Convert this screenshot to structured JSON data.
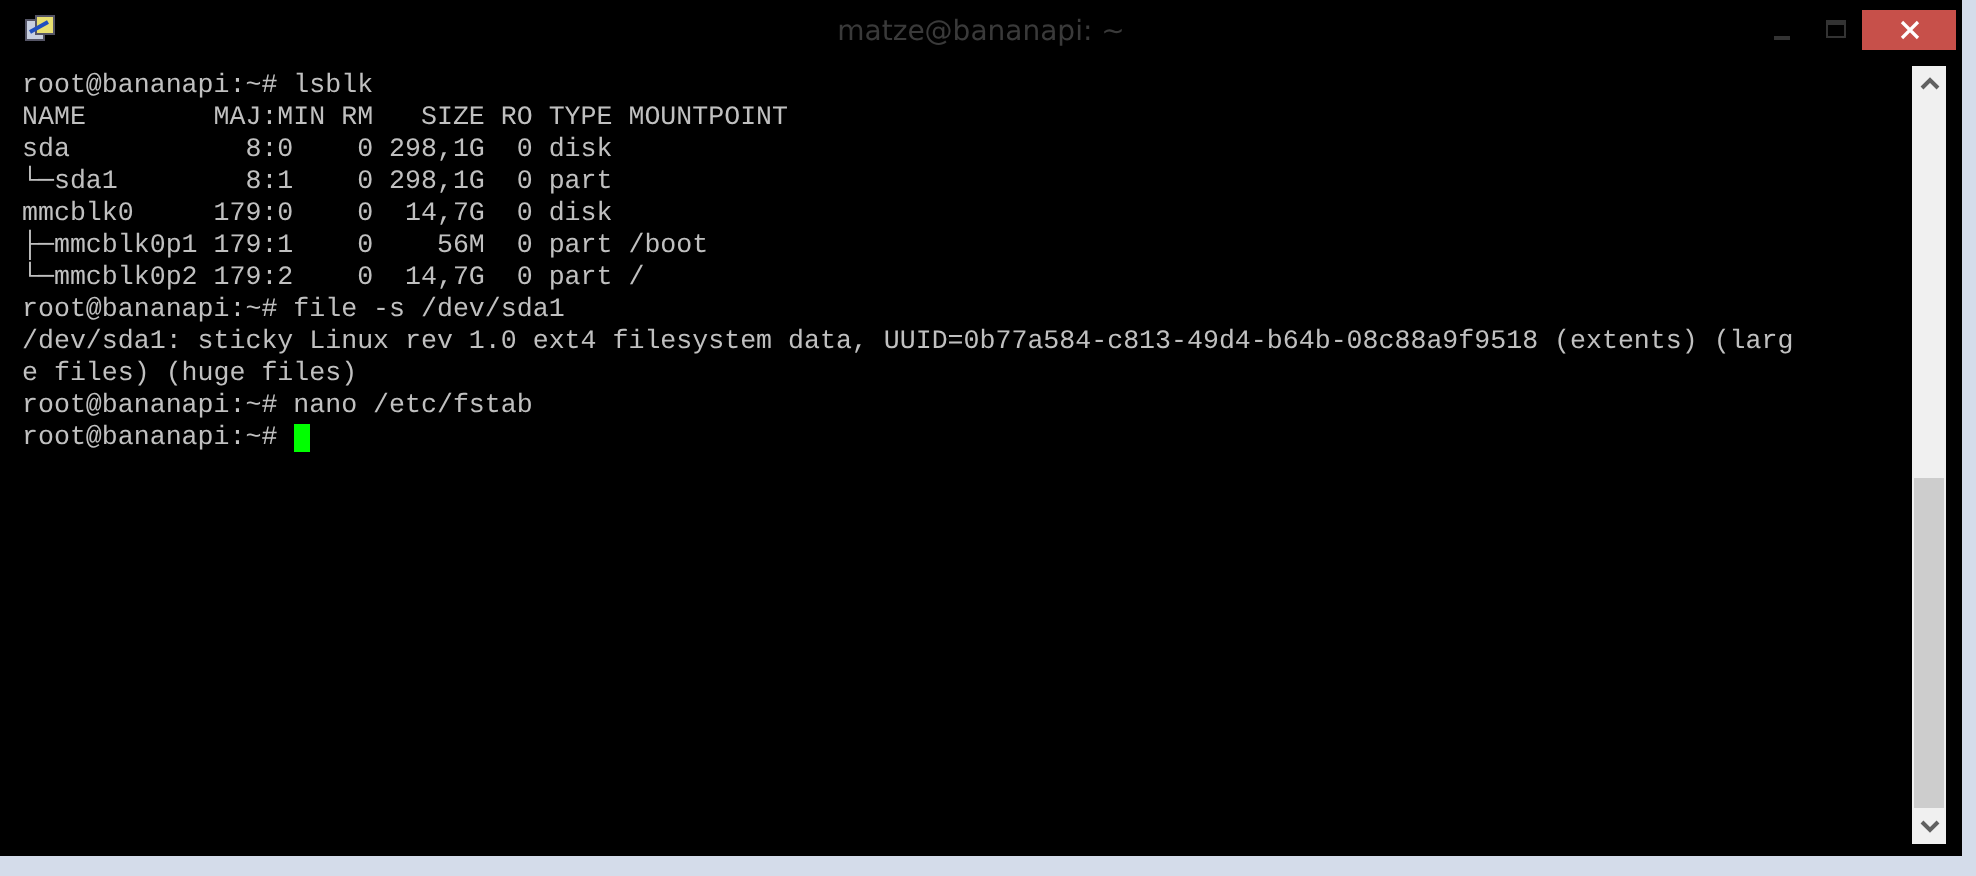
{
  "window": {
    "title": "matze@bananapi: ~"
  },
  "terminal": {
    "lines": [
      "root@bananapi:~# lsblk",
      "NAME        MAJ:MIN RM   SIZE RO TYPE MOUNTPOINT",
      "sda           8:0    0 298,1G  0 disk",
      "└─sda1        8:1    0 298,1G  0 part",
      "mmcblk0     179:0    0  14,7G  0 disk",
      "├─mmcblk0p1 179:1    0    56M  0 part /boot",
      "└─mmcblk0p2 179:2    0  14,7G  0 part /",
      "root@bananapi:~# file -s /dev/sda1",
      "/dev/sda1: sticky Linux rev 1.0 ext4 filesystem data, UUID=0b77a584-c813-49d4-b64b-08c88a9f9518 (extents) (larg",
      "e files) (huge files)",
      "root@bananapi:~# nano /etc/fstab",
      "root@bananapi:~# "
    ],
    "cursor": true
  }
}
